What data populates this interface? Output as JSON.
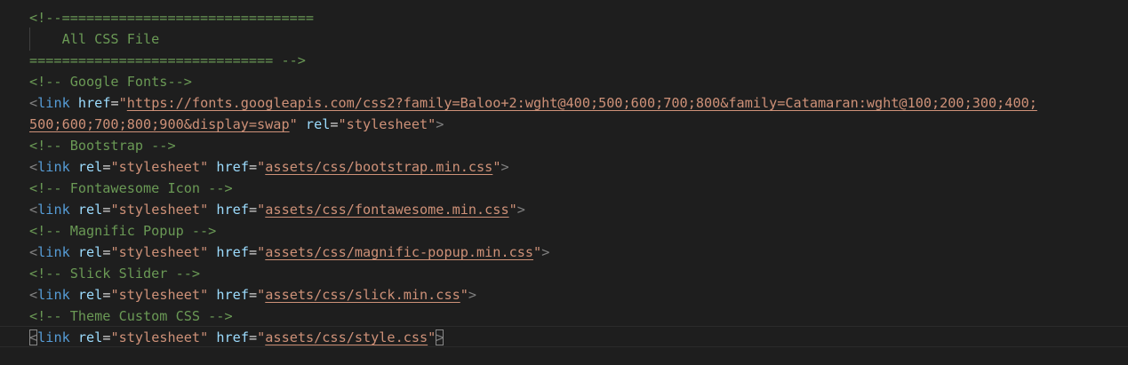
{
  "editor": {
    "comment_block": {
      "open": "<!--===============================",
      "title": "    All CSS File",
      "close": "============================== -->"
    },
    "lines": [
      {
        "comment": "<!-- Google Fonts-->",
        "attrs": [
          {
            "name": "href",
            "value": "https://fonts.googleapis.com/css2?family=Baloo+2:wght@400;500;600;700;800&family=Catamaran:wght@100;200;300;400;",
            "continued": "500;600;700;800;900&display=swap"
          },
          {
            "name": "rel",
            "value": "stylesheet"
          }
        ]
      },
      {
        "comment": "<!-- Bootstrap -->",
        "href": "assets/css/bootstrap.min.css"
      },
      {
        "comment": "<!-- Fontawesome Icon -->",
        "href": "assets/css/fontawesome.min.css"
      },
      {
        "comment": "<!-- Magnific Popup -->",
        "href": "assets/css/magnific-popup.min.css"
      },
      {
        "comment": "<!-- Slick Slider -->",
        "href": "assets/css/slick.min.css"
      },
      {
        "comment": "<!-- Theme Custom CSS -->",
        "href": "assets/css/style.css"
      }
    ],
    "syntax": {
      "tag_name": "link",
      "rel_attr": "rel",
      "href_attr": "href",
      "rel_value": "stylesheet"
    },
    "colors": {
      "background": "#1e1e1e",
      "comment": "#6a9955",
      "punctuation": "#808080",
      "tag": "#569cd6",
      "attribute": "#9cdcfe",
      "string": "#ce9178"
    }
  }
}
